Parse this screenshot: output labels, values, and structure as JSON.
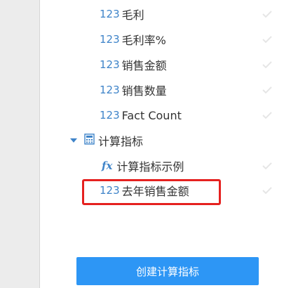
{
  "fields": [
    {
      "type_label": "123",
      "name": "毛利"
    },
    {
      "type_label": "123",
      "name": "毛利率%"
    },
    {
      "type_label": "123",
      "name": "销售金额"
    },
    {
      "type_label": "123",
      "name": "销售数量"
    },
    {
      "type_label": "123",
      "name": "Fact Count"
    }
  ],
  "calc_folder": {
    "name": "计算指标",
    "icon": "calculator-icon",
    "expanded": true,
    "items": [
      {
        "type_label": "fx",
        "name": "计算指标示例"
      },
      {
        "type_label": "123",
        "name": "去年销售金额"
      }
    ]
  },
  "actions": {
    "create_label": "创建计算指标"
  },
  "colors": {
    "accent": "#3f84c9",
    "button": "#2d96f5",
    "highlight": "#e5211f"
  }
}
